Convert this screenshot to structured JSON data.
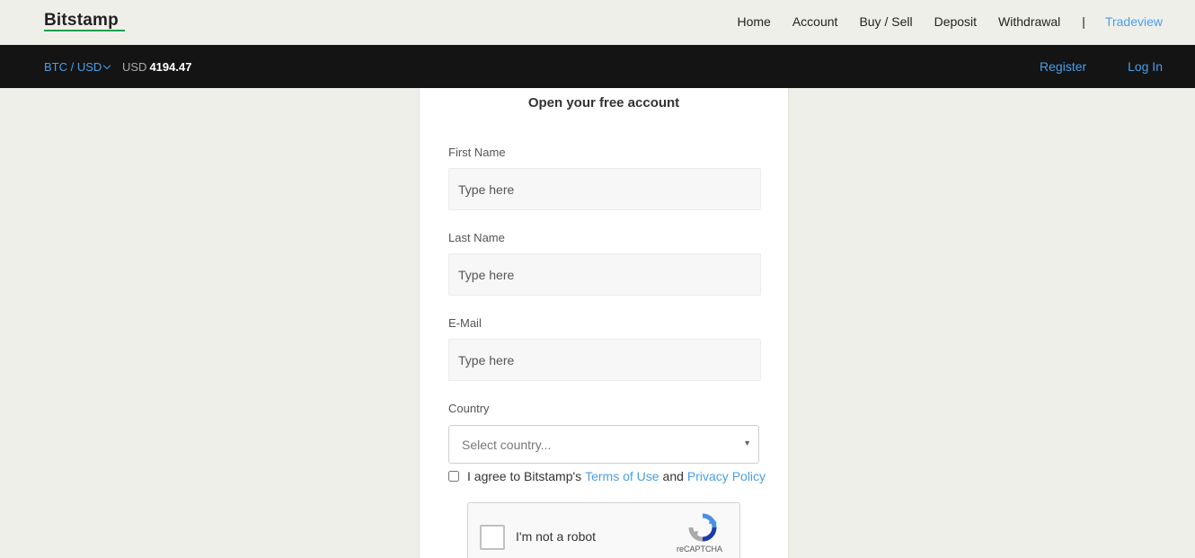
{
  "header": {
    "logo": "Bitstamp",
    "nav": [
      "Home",
      "Account",
      "Buy / Sell",
      "Deposit",
      "Withdrawal"
    ],
    "separator": "|",
    "tradeview": "Tradeview"
  },
  "ticker": {
    "pair": "BTC / USD",
    "currency": "USD",
    "price": "4194.47",
    "register": "Register",
    "login": "Log In"
  },
  "form": {
    "title": "Open your free account",
    "first_name_label": "First Name",
    "first_name_placeholder": "Type here",
    "last_name_label": "Last Name",
    "last_name_placeholder": "Type here",
    "email_label": "E-Mail",
    "email_placeholder": "Type here",
    "country_label": "Country",
    "country_placeholder": "Select country...",
    "agree_prefix": "I agree to Bitstamp's",
    "terms": "Terms of Use",
    "and": "and",
    "privacy": "Privacy Policy"
  },
  "captcha": {
    "label": "I'm not a robot",
    "brand": "reCAPTCHA"
  },
  "colors": {
    "accent": "#4a9fe6",
    "logo_underline": "#19a34a",
    "dark_bar": "#141414",
    "page_bg": "#efefea"
  }
}
